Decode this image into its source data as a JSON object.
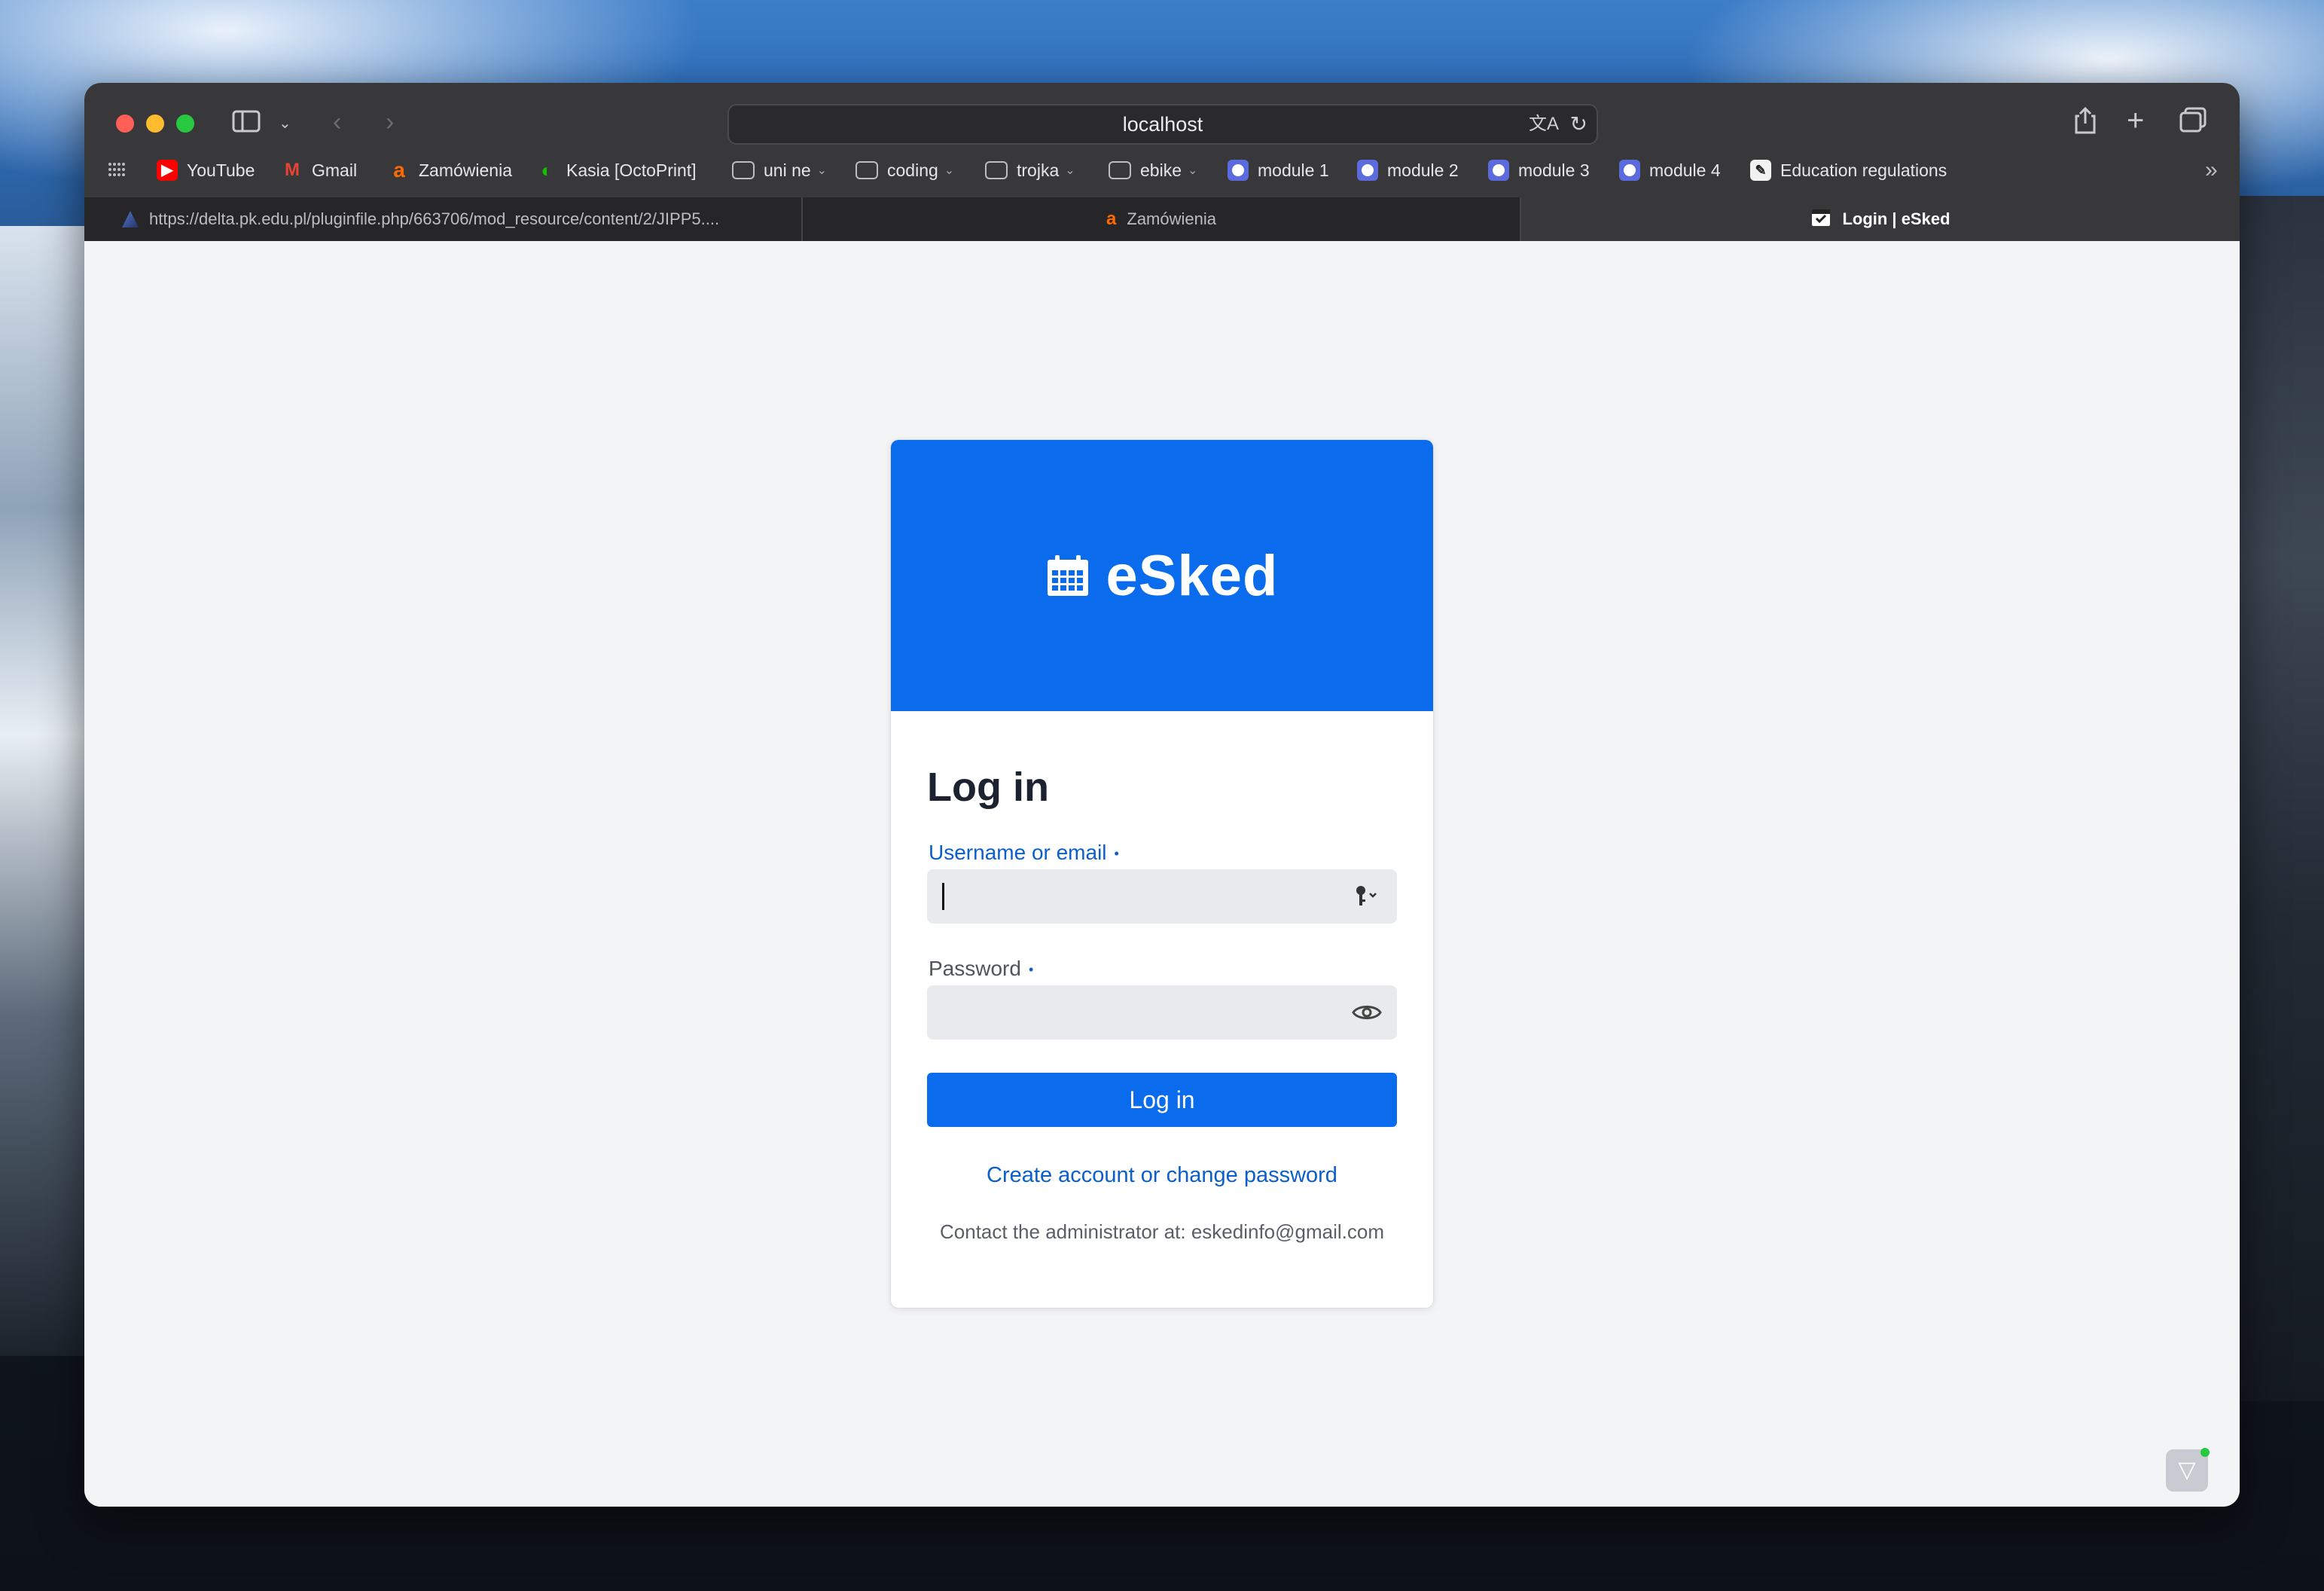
{
  "browser": {
    "url": "localhost",
    "bookmarks": [
      {
        "label": "YouTube",
        "icon": "youtube-icon",
        "folder": false
      },
      {
        "label": "Gmail",
        "icon": "gmail-icon",
        "folder": false
      },
      {
        "label": "Zamówienia",
        "icon": "allegro-icon",
        "folder": false
      },
      {
        "label": "Kasia [OctoPrint]",
        "icon": "octoprint-icon",
        "folder": false
      },
      {
        "label": "uni ne",
        "icon": "folder-icon",
        "folder": true
      },
      {
        "label": "coding",
        "icon": "folder-icon",
        "folder": true
      },
      {
        "label": "trojka",
        "icon": "folder-icon",
        "folder": true
      },
      {
        "label": "ebike",
        "icon": "folder-icon",
        "folder": true
      },
      {
        "label": "module 1",
        "icon": "module-icon",
        "folder": false
      },
      {
        "label": "module 2",
        "icon": "module-icon",
        "folder": false
      },
      {
        "label": "module 3",
        "icon": "module-icon",
        "folder": false
      },
      {
        "label": "module 4",
        "icon": "module-icon",
        "folder": false
      },
      {
        "label": "Education regulations",
        "icon": "education-icon",
        "folder": false
      }
    ],
    "tabs": [
      {
        "title": "https://delta.pk.edu.pl/pluginfile.php/663706/mod_resource/content/2/JIPP5....",
        "icon": "delta-icon",
        "active": false
      },
      {
        "title": "Zamówienia",
        "icon": "allegro-icon",
        "active": false
      },
      {
        "title": "Login | eSked",
        "icon": "calendar-check-icon",
        "active": true
      }
    ]
  },
  "login": {
    "brand": "eSked",
    "title": "Log in",
    "username_label": "Username or email",
    "required_mark": "•",
    "username_value": "",
    "password_label": "Password",
    "password_value": "",
    "submit_label": "Log in",
    "create_link": "Create account or change password",
    "contact_text": "Contact the administrator at: eskedinfo@gmail.com"
  },
  "colors": {
    "brand_blue": "#0a6ced",
    "link_blue": "#0a5fcc",
    "page_bg": "#f3f4f6"
  }
}
